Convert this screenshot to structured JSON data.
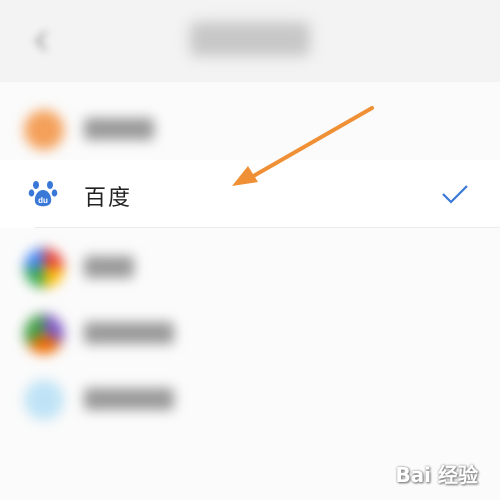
{
  "header": {
    "back_icon": "chevron-left-icon"
  },
  "list": {
    "selected_engine": {
      "label": "百度",
      "icon": "baidu-paw-icon",
      "checked": true,
      "accent": "#3a78d8"
    }
  },
  "arrow_color": "#f09036",
  "watermark": {
    "text": "Bai 经验"
  }
}
